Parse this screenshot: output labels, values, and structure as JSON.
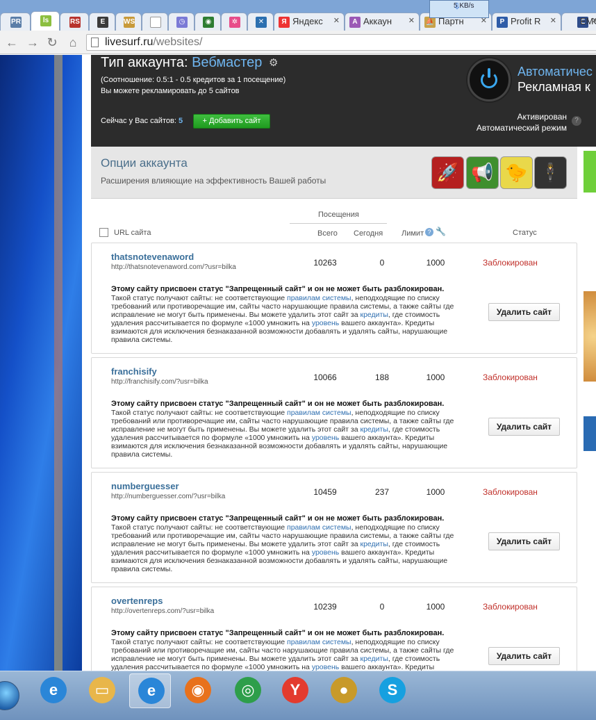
{
  "browser": {
    "tabs": [
      {
        "label": "",
        "favicon": "pr-cy-icon",
        "fav_text": "PR\nSE",
        "fav_color": "#5b7ea8"
      },
      {
        "label": "",
        "favicon": "liveseo-icon",
        "fav_text": "ls",
        "fav_color": "#8cbf3f"
      },
      {
        "label": "",
        "favicon": "rs-icon",
        "fav_text": "RS",
        "fav_color": "#b8332d"
      },
      {
        "label": "",
        "favicon": "e-icon",
        "fav_text": "E",
        "fav_color": "#3b3b3b"
      },
      {
        "label": "",
        "favicon": "websurf-icon",
        "fav_text": "WS",
        "fav_color": "#c89a3a"
      },
      {
        "label": "",
        "favicon": "blank-page-icon",
        "fav_text": "",
        "fav_color": "#ffffff"
      },
      {
        "label": "",
        "favicon": "clock-icon",
        "fav_text": "◷",
        "fav_color": "#7a7ad6"
      },
      {
        "label": "",
        "favicon": "ring-icon",
        "fav_text": "◉",
        "fav_color": "#2e7d32"
      },
      {
        "label": "",
        "favicon": "pinwheel-icon",
        "fav_text": "✲",
        "fav_color": "#e84d8a"
      },
      {
        "label": "",
        "favicon": "scissors-icon",
        "fav_text": "✕",
        "fav_color": "#2b6fb0"
      },
      {
        "label": "Яндекс",
        "favicon": "yandex-icon",
        "fav_text": "Я",
        "fav_color": "#e33"
      },
      {
        "label": "Аккаун",
        "favicon": "account-icon",
        "fav_text": "A",
        "fav_color": "#9b59b6"
      },
      {
        "label": "Партн",
        "favicon": "partner-icon",
        "fav_text": "⛵",
        "fav_color": "#c8a24a"
      },
      {
        "label": "Profit R",
        "favicon": "profit-icon",
        "fav_text": "P",
        "fav_color": "#2e5ca8"
      },
      {
        "label": "EMC",
        "favicon": "emc-icon",
        "fav_text": "E",
        "fav_color": "#2e4c8a"
      }
    ],
    "net_speed": "5 KB/s",
    "url_host": "livesurf.ru",
    "url_path": "/websites/"
  },
  "header": {
    "title_prefix": "Тип аккаунта: ",
    "account_type": "Вебмастер",
    "ratio": "(Соотношение: 0.5:1 - 0.5 кредитов за 1 посещение)",
    "limit_note": "Вы можете рекламировать до 5 сайтов",
    "now_label": "Сейчас у Вас сайтов: ",
    "now_count": "5",
    "add_site": "+ Добавить сайт",
    "auto_title": "Автоматичес",
    "auto_subtitle": "Рекламная к",
    "activated": "Активирован",
    "auto_mode": "Автоматический режим"
  },
  "options": {
    "title": "Опции аккаунта",
    "subtitle": "Расширения влияющие на эффективность Вашей работы",
    "icons": [
      {
        "name": "rocket-icon",
        "glyph": "🚀",
        "bg": "#b52020"
      },
      {
        "name": "megaphone-icon",
        "glyph": "📢",
        "bg": "#3f8f2e"
      },
      {
        "name": "chick-icon",
        "glyph": "🐤",
        "bg": "#e9d84a"
      },
      {
        "name": "agent-icon",
        "glyph": "🕴",
        "bg": "#333333"
      }
    ]
  },
  "table": {
    "visits": "Посещения",
    "col_url": "URL сайта",
    "col_total": "Всего",
    "col_today": "Сегодня",
    "col_limit": "Лимит",
    "col_status": "Статус",
    "warn": "Этому сайту присвоен статус \"Запрещенный сайт\" и он не может быть разблокирован.",
    "desc_1": "Такой статус получают сайты: не соответствующие ",
    "desc_link_rules": "правилам системы",
    "desc_2": ", неподходящие по списку требований или противоречащие им, сайты часто нарушающие правила системы, а также сайты где исправление не могут быть применены. Вы можете удалить этот сайт за ",
    "desc_link_credits": "кредиты",
    "desc_3": ", где стоимость удаления рассчитывается по формуле «1000 умножить на ",
    "desc_link_level": "уровень",
    "desc_4": " вашего аккаунта». Кредиты взимаются для исключения безнаказанной возможности добавлять и удалять сайты, нарушающие правила системы.",
    "delete_label": "Удалить сайт"
  },
  "sites": [
    {
      "name": "thatsnotevenaword",
      "url": "http://thatsnotevenaword.com/?usr=bilka",
      "total": "10263",
      "today": "0",
      "limit": "1000",
      "status": "Заблокирован"
    },
    {
      "name": "franchisify",
      "url": "http://franchisify.com/?usr=bilka",
      "total": "10066",
      "today": "188",
      "limit": "1000",
      "status": "Заблокирован"
    },
    {
      "name": "numberguesser",
      "url": "http://numberguesser.com/?usr=bilka",
      "total": "10459",
      "today": "237",
      "limit": "1000",
      "status": "Заблокирован"
    },
    {
      "name": "overtenreps",
      "url": "http://overtenreps.com/?usr=bilka",
      "total": "10239",
      "today": "0",
      "limit": "1000",
      "status": "Заблокирован"
    }
  ],
  "taskbar": [
    {
      "name": "ie-taskbar-icon",
      "glyph": "e",
      "bg": "#2a86d8"
    },
    {
      "name": "explorer-taskbar-icon",
      "glyph": "▭",
      "bg": "#e8b64a"
    },
    {
      "name": "ie-active-taskbar-icon",
      "glyph": "e",
      "bg": "#2a86d8"
    },
    {
      "name": "firefox-taskbar-icon",
      "glyph": "◉",
      "bg": "#e8711c"
    },
    {
      "name": "chrome-taskbar-icon",
      "glyph": "◎",
      "bg": "#2e9e4a"
    },
    {
      "name": "yandex-browser-taskbar-icon",
      "glyph": "Y",
      "bg": "#e33b2e"
    },
    {
      "name": "coin-taskbar-icon",
      "glyph": "●",
      "bg": "#c89a2a"
    },
    {
      "name": "skype-taskbar-icon",
      "glyph": "S",
      "bg": "#16a0e0"
    }
  ]
}
